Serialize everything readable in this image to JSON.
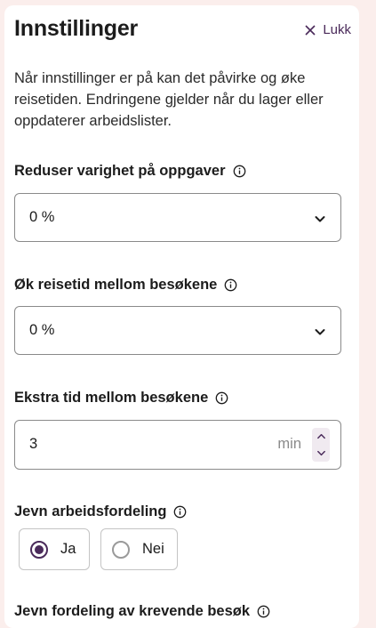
{
  "header": {
    "title": "Innstillinger",
    "close_label": "Lukk"
  },
  "description": "Når innstillinger er på kan det påvirke og øke reisetiden. Endringene gjelder når du lager eller oppdaterer arbeidslister.",
  "fields": {
    "reduce_duration": {
      "label": "Reduser varighet på oppgaver",
      "value": "0 %",
      "icon": "info-icon"
    },
    "increase_travel": {
      "label": "Øk reisetid mellom besøkene",
      "value": "0 %",
      "icon": "info-icon"
    },
    "extra_time": {
      "label": "Ekstra tid mellom besøkene",
      "value": "3",
      "unit": "min",
      "icon": "info-icon"
    },
    "even_distribution": {
      "label": "Jevn arbeidsfordeling",
      "options": [
        {
          "label": "Ja",
          "selected": true
        },
        {
          "label": "Nei",
          "selected": false
        }
      ]
    },
    "demanding_visits": {
      "label": "Jevn fordeling av krevende besøk"
    }
  },
  "colors": {
    "accent": "#4a2a5a",
    "background": "#fbeeec",
    "border": "#8a8a8a"
  }
}
